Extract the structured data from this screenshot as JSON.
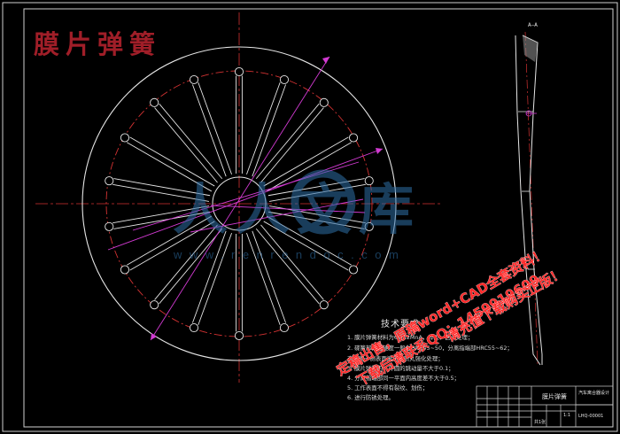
{
  "drawing": {
    "title": "膜片弹簧",
    "section_label": "A—A",
    "watermark_brand": "人人文库",
    "watermark_url": "www.renrendoc.com",
    "promo_lines": [
      "定稿出售，原稿word+CAD全套资料！",
      "下载后请联系QQ：1459919609",
      "请充值下载购买正版！"
    ],
    "spring": {
      "finger_count": 18
    }
  },
  "tech": {
    "heading": "技术要求",
    "lines": [
      "1. 膜片弹簧材料为60Si2MnA，淬火、回火处理；",
      "2. 碟簧部分的硬度一般为HRC45~50，分离指端部HRC55~62；",
      "   支承圈一侧表面滚压、喷丸强化处理；",
      "3. 膜片弹簧内、外圆的跳动量不大于0.1；",
      "4. 分离指端部同一平面内高度差不大于0.5；",
      "5. 工作表面不得有裂纹、划伤；",
      "6. 进行防锈处理。"
    ]
  },
  "titleblock": {
    "part_name": "膜片弹簧",
    "institution": "汽车离合器设计",
    "drawing_no": "LHQ-00001",
    "scale": "1:1",
    "sheet": "共1张"
  }
}
